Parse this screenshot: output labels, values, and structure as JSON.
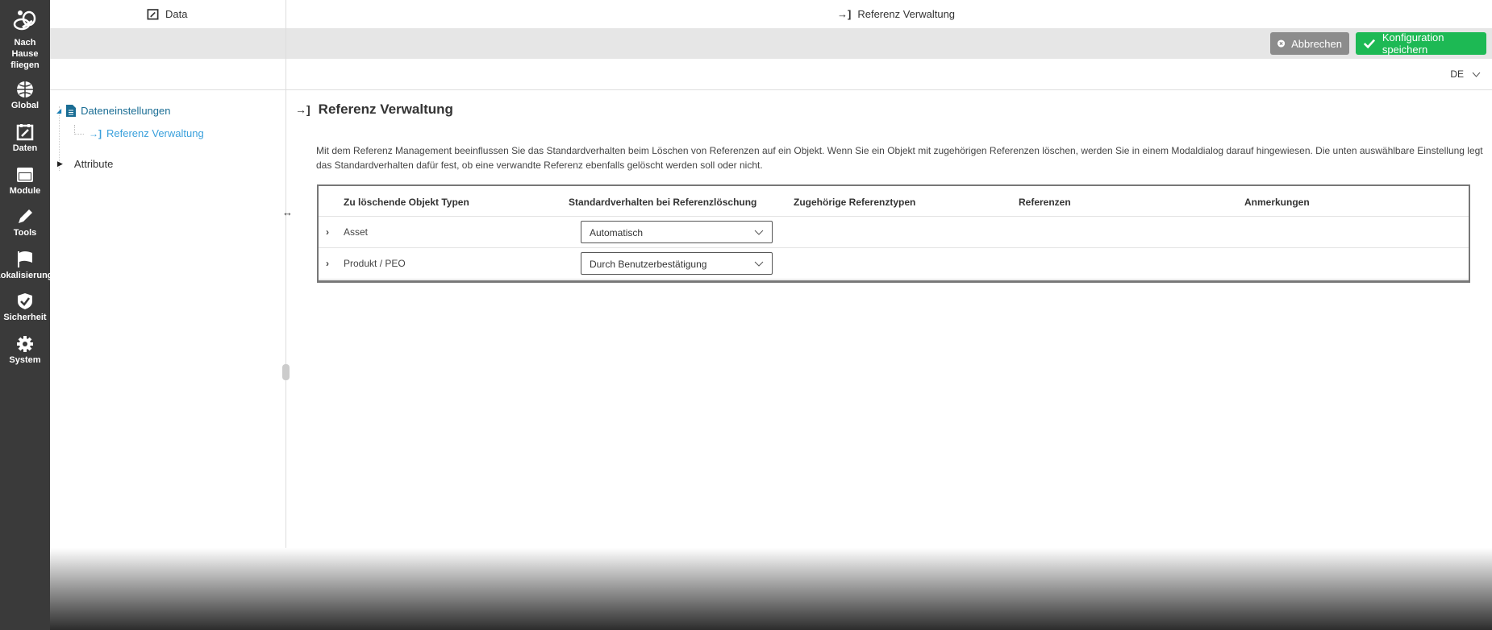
{
  "sidebar": {
    "items": [
      {
        "label": "Nach Hause fliegen",
        "icon": "bee-icon"
      },
      {
        "label": "Global",
        "icon": "globe-icon"
      },
      {
        "label": "Daten",
        "icon": "calendar-edit-icon"
      },
      {
        "label": "Module",
        "icon": "window-icon"
      },
      {
        "label": "Tools",
        "icon": "pencil-icon"
      },
      {
        "label": "Lokalisierung",
        "icon": "flag-icon"
      },
      {
        "label": "Sicherheit",
        "icon": "shield-check-icon"
      },
      {
        "label": "System",
        "icon": "gear-icon"
      }
    ]
  },
  "tabs": [
    {
      "label": "Data",
      "icon": "calendar-edit-icon"
    },
    {
      "label": "Referenz Verwaltung",
      "icon": "sign-in-icon"
    }
  ],
  "toolbar": {
    "cancel_label": "Abbrechen",
    "save_label": "Konfiguration speichern",
    "cancel_color": "#8c8c8c",
    "save_color": "#1db954"
  },
  "language": {
    "value": "DE"
  },
  "tree": {
    "items": [
      {
        "label": "Dateneinstellungen",
        "expanded": true,
        "children": [
          {
            "label": "Referenz Verwaltung",
            "selected": true
          }
        ]
      },
      {
        "label": "Attribute",
        "expanded": false
      }
    ]
  },
  "main": {
    "title": "Referenz Verwaltung",
    "description": "Mit dem Referenz Management beeinflussen Sie das Standardverhalten beim Löschen von Referenzen auf ein Objekt. Wenn Sie ein Objekt mit zugehörigen Referenzen löschen, werden Sie in einem Modaldialog darauf hingewiesen. Die unten auswählbare Einstellung legt das Standardverhalten dafür fest, ob eine verwandte Referenz ebenfalls gelöscht werden soll oder nicht.",
    "table": {
      "headers": [
        "Zu löschende Objekt Typen",
        "Standardverhalten bei Referenzlöschung",
        "Zugehörige Referenztypen",
        "Referenzen",
        "Anmerkungen"
      ],
      "rows": [
        {
          "type": "Asset",
          "behavior": "Automatisch"
        },
        {
          "type": "Produkt / PEO",
          "behavior": "Durch Benutzerbestätigung"
        }
      ]
    }
  }
}
